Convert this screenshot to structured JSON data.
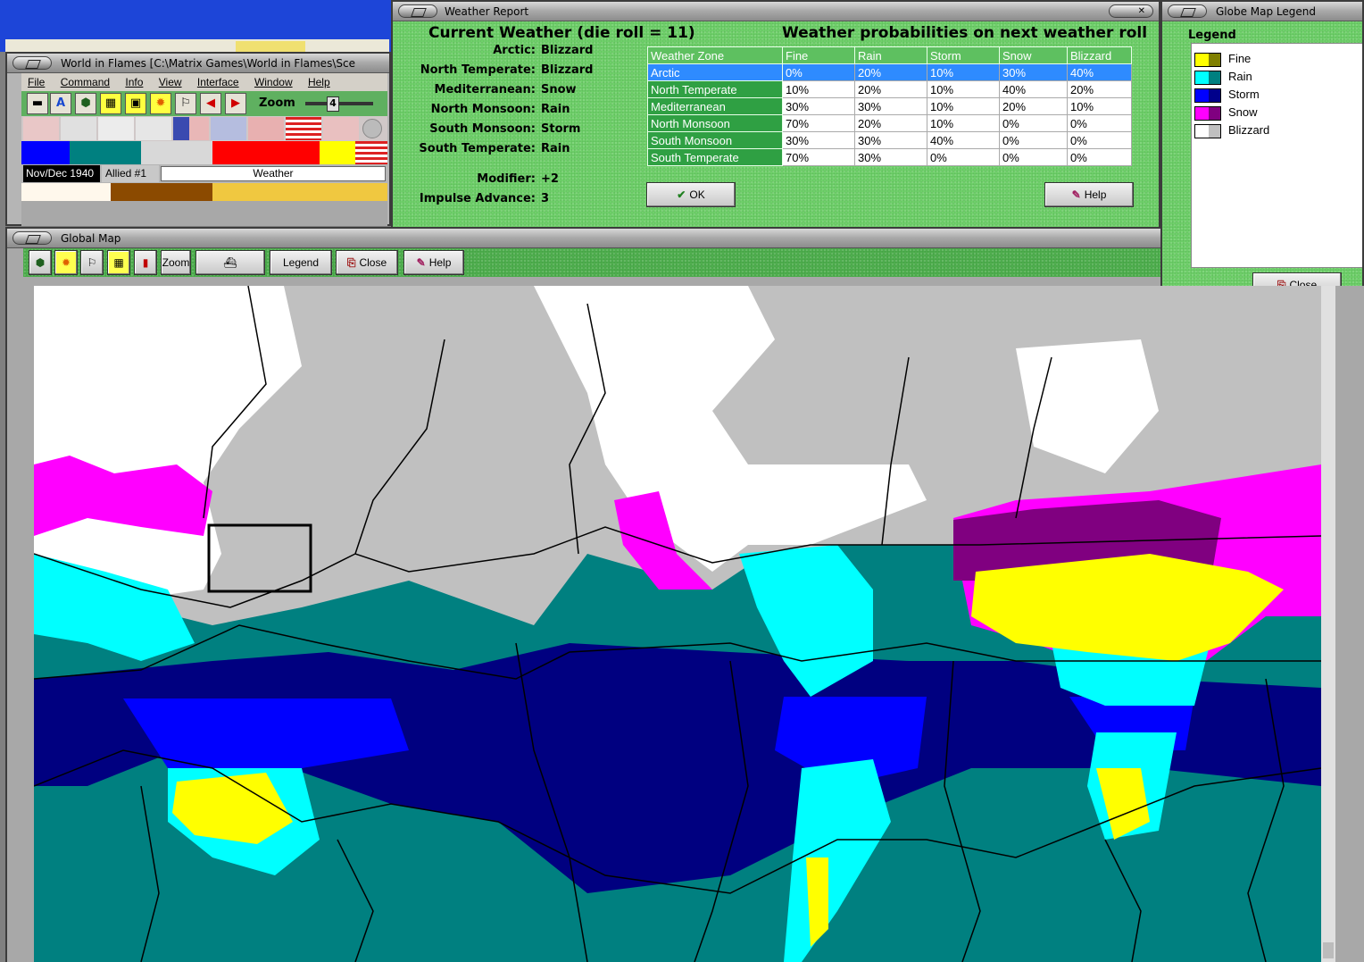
{
  "main_window": {
    "title": "World in Flames [C:\\Matrix Games\\World in Flames\\Sce",
    "menu": [
      "File",
      "Command",
      "Info",
      "View",
      "Interface",
      "Window",
      "Help"
    ],
    "zoom_label": "Zoom",
    "zoom_value": "4",
    "date": "Nov/Dec 1940",
    "side": "Allied #1",
    "status": "Weather"
  },
  "weather_report": {
    "title": "Weather Report",
    "heading_current": "Current Weather (die roll = 11)",
    "heading_prob": "Weather probabilities on next weather roll",
    "current": [
      {
        "zone": "Arctic:",
        "weather": "Blizzard"
      },
      {
        "zone": "North Temperate:",
        "weather": "Blizzard"
      },
      {
        "zone": "Mediterranean:",
        "weather": "Snow"
      },
      {
        "zone": "North Monsoon:",
        "weather": "Rain"
      },
      {
        "zone": "South Monsoon:",
        "weather": "Storm"
      },
      {
        "zone": "South Temperate:",
        "weather": "Rain"
      }
    ],
    "modifier_label": "Modifier:",
    "modifier_value": "+2",
    "impulse_label": "Impulse Advance:",
    "impulse_value": "3",
    "table": {
      "headers": [
        "Weather Zone",
        "Fine",
        "Rain",
        "Storm",
        "Snow",
        "Blizzard"
      ],
      "rows": [
        {
          "zone": "Arctic",
          "values": [
            "0%",
            "20%",
            "10%",
            "30%",
            "40%"
          ],
          "selected": true
        },
        {
          "zone": "North Temperate",
          "values": [
            "10%",
            "20%",
            "10%",
            "40%",
            "20%"
          ]
        },
        {
          "zone": "Mediterranean",
          "values": [
            "30%",
            "30%",
            "10%",
            "20%",
            "10%"
          ]
        },
        {
          "zone": "North Monsoon",
          "values": [
            "70%",
            "20%",
            "10%",
            "0%",
            "0%"
          ]
        },
        {
          "zone": "South Monsoon",
          "values": [
            "30%",
            "30%",
            "40%",
            "0%",
            "0%"
          ]
        },
        {
          "zone": "South Temperate",
          "values": [
            "70%",
            "30%",
            "0%",
            "0%",
            "0%"
          ]
        }
      ]
    },
    "ok_label": "OK",
    "help_label": "Help"
  },
  "global_map": {
    "title": "Global Map",
    "zoom_label": "Zoom",
    "legend_label": "Legend",
    "close_label": "Close",
    "help_label": "Help"
  },
  "globe_legend": {
    "title": "Globe Map Legend",
    "heading": "Legend",
    "items": [
      {
        "label": "Fine",
        "color_a": "#ffff00",
        "color_b": "#808000"
      },
      {
        "label": "Rain",
        "color_a": "#00ffff",
        "color_b": "#008080"
      },
      {
        "label": "Storm",
        "color_a": "#0000ff",
        "color_b": "#00008b"
      },
      {
        "label": "Snow",
        "color_a": "#ff00ff",
        "color_b": "#800080"
      },
      {
        "label": "Blizzard",
        "color_a": "#ffffff",
        "color_b": "#c0c0c0"
      }
    ],
    "close_label": "Close"
  },
  "colors": {
    "felt_green": "#6fcf6a",
    "ocean_rain": "#008080",
    "ocean_storm": "#000080",
    "storm_land": "#0000ff",
    "snow": "#ff00ff",
    "blizzard_grey": "#c0c0c0"
  }
}
